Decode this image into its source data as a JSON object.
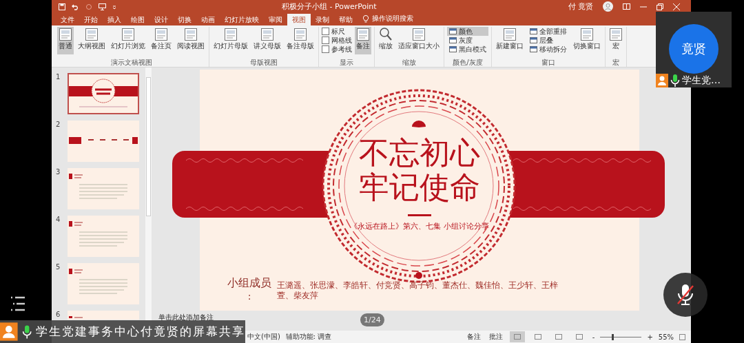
{
  "title_bar": {
    "title": "积极分子小组 - PowerPoint",
    "user": "付 竟贤"
  },
  "ribbon_tabs": [
    {
      "label": "文件",
      "selected": false
    },
    {
      "label": "开始",
      "selected": false
    },
    {
      "label": "插入",
      "selected": false
    },
    {
      "label": "绘图",
      "selected": false
    },
    {
      "label": "设计",
      "selected": false
    },
    {
      "label": "切换",
      "selected": false
    },
    {
      "label": "动画",
      "selected": false
    },
    {
      "label": "幻灯片放映",
      "selected": false
    },
    {
      "label": "审阅",
      "selected": false
    },
    {
      "label": "视图",
      "selected": true
    },
    {
      "label": "录制",
      "selected": false
    },
    {
      "label": "帮助",
      "selected": false
    }
  ],
  "tell_me": "操作说明搜索",
  "ribbon_groups": [
    {
      "label": "演示文稿视图",
      "items": [
        {
          "kind": "large",
          "label": "普通",
          "selected": true
        },
        {
          "kind": "large",
          "label": "大纲视图",
          "selected": false
        },
        {
          "kind": "large",
          "label": "幻灯片浏览",
          "selected": false
        },
        {
          "kind": "large",
          "label": "备注页",
          "selected": false
        },
        {
          "kind": "large",
          "label": "阅读视图",
          "selected": false
        }
      ]
    },
    {
      "label": "母版视图",
      "items": [
        {
          "kind": "large",
          "label": "幻灯片母版",
          "selected": false
        },
        {
          "kind": "large",
          "label": "讲义母版",
          "selected": false
        },
        {
          "kind": "large",
          "label": "备注母版",
          "selected": false
        }
      ]
    },
    {
      "label": "显示",
      "items": [
        {
          "kind": "column",
          "items": [
            {
              "kind": "check",
              "label": "标尺",
              "checked": false
            },
            {
              "kind": "check",
              "label": "网格线",
              "checked": false
            },
            {
              "kind": "check",
              "label": "参考线",
              "checked": false
            }
          ]
        },
        {
          "kind": "large",
          "label": "备注",
          "selected": true
        }
      ]
    },
    {
      "label": "缩放",
      "items": [
        {
          "kind": "large",
          "label": "缩放",
          "selected": false
        },
        {
          "kind": "large",
          "label": "适应窗口大小",
          "selected": false
        }
      ]
    },
    {
      "label": "颜色/灰度",
      "items": [
        {
          "kind": "column",
          "items": [
            {
              "kind": "small",
              "label": "颜色",
              "selected": true
            },
            {
              "kind": "small",
              "label": "灰度",
              "selected": false
            },
            {
              "kind": "small",
              "label": "黑白模式",
              "selected": false
            }
          ]
        }
      ]
    },
    {
      "label": "窗口",
      "items": [
        {
          "kind": "large",
          "label": "新建窗口",
          "selected": false
        },
        {
          "kind": "column",
          "items": [
            {
              "kind": "small",
              "label": "全部重排",
              "selected": false
            },
            {
              "kind": "small",
              "label": "层叠",
              "selected": false
            },
            {
              "kind": "small",
              "label": "移动拆分",
              "selected": false
            }
          ]
        },
        {
          "kind": "large",
          "label": "切换窗口",
          "selected": false
        }
      ]
    },
    {
      "label": "宏",
      "items": [
        {
          "kind": "large",
          "label": "宏",
          "selected": false
        }
      ]
    }
  ],
  "thumbnails": [
    {
      "number": "1",
      "kind": "title",
      "selected": true
    },
    {
      "number": "2",
      "kind": "agenda",
      "selected": false
    },
    {
      "number": "3",
      "kind": "text",
      "selected": false
    },
    {
      "number": "4",
      "kind": "text",
      "selected": false
    },
    {
      "number": "5",
      "kind": "text",
      "selected": false
    },
    {
      "number": "6",
      "kind": "text",
      "selected": false
    }
  ],
  "slide": {
    "title_lines": [
      "不忘初心",
      "牢记使命"
    ],
    "subtitle": "《永远在路上》第六、七集 小组讨论分享",
    "members_label": "小组成员",
    "members_colon": ":",
    "members": "王潞遥、张思濛、李皓轩、付竞贤、高子钧、董杰仕、魏佳怡、王少轩、王梓萱、柴友萍"
  },
  "notes_placeholder": "单击此处添加备注",
  "page_indicator": "1/24",
  "status_bar": {
    "language": "中文(中国)",
    "accessibility": "辅助功能: 调查",
    "notes": "备注",
    "comments": "批注",
    "view_buttons": [
      {
        "selected": true
      },
      {
        "selected": false
      },
      {
        "selected": false
      },
      {
        "selected": false
      }
    ],
    "zoom_out": "-",
    "zoom_in": "+",
    "zoom_slider": {
      "level": 0.27
    },
    "zoom": "55%"
  },
  "video_tile": {
    "avatar_text": "竟贤",
    "name": "学生党…"
  },
  "mute_button": {
    "muted": true
  },
  "share_banner": {
    "text": "学生党建事务中心付竟贤的屏幕共享"
  }
}
